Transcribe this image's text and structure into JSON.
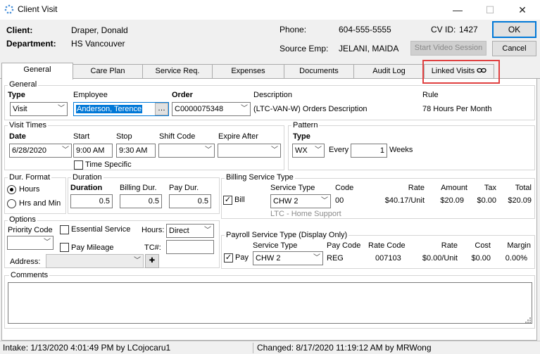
{
  "window": {
    "title": "Client Visit",
    "minimize_glyph": "—",
    "maximize_glyph": "☐",
    "close_glyph": "✕"
  },
  "header": {
    "client_label": "Client:",
    "client_value": "Draper, Donald",
    "department_label": "Department:",
    "department_value": "HS Vancouver",
    "phone_label": "Phone:",
    "phone_value": "604-555-5555",
    "cvid_label": "CV ID:",
    "cvid_value": "1427",
    "source_emp_label": "Source Emp:",
    "source_emp_value": "JELANI, MAIDA",
    "video_button": "Start Video Session",
    "ok_button": "OK",
    "cancel_button": "Cancel"
  },
  "tabs": [
    "General",
    "Care Plan",
    "Service Req.",
    "Expenses",
    "Documents",
    "Audit Log",
    "Linked Visits"
  ],
  "active_tab": "General",
  "general": {
    "group_label": "General",
    "type_label": "Type",
    "type_value": "Visit",
    "employee_label": "Employee",
    "employee_value": "Anderson, Terence",
    "employee_button": "…",
    "order_label": "Order",
    "order_value": "C0000075348",
    "description_label": "Description",
    "description_value": "(LTC-VAN-W) Orders Description",
    "rule_label": "Rule",
    "rule_value": "78 Hours Per Month"
  },
  "visit_times": {
    "group_label": "Visit Times",
    "date_label": "Date",
    "date_value": "6/28/2020",
    "start_label": "Start",
    "start_value": "9:00 AM",
    "stop_label": "Stop",
    "stop_value": "9:30 AM",
    "shift_code_label": "Shift Code",
    "shift_code_value": "",
    "expire_after_label": "Expire After",
    "expire_after_value": "",
    "time_specific_label": "Time Specific"
  },
  "pattern": {
    "group_label": "Pattern",
    "type_label": "Type",
    "type_value": "WX",
    "every_label": "Every",
    "every_value": "1",
    "weeks_label": "Weeks"
  },
  "dur_format": {
    "group_label": "Dur. Format",
    "hours_label": "Hours",
    "hrs_min_label": "Hrs and Min"
  },
  "duration": {
    "group_label": "Duration",
    "duration_label": "Duration",
    "duration_value": "0.5",
    "billing_dur_label": "Billing Dur.",
    "billing_dur_value": "0.5",
    "pay_dur_label": "Pay Dur.",
    "pay_dur_value": "0.5"
  },
  "billing": {
    "group_label": "Billing Service Type",
    "bill_label": "Bill",
    "service_type_label": "Service Type",
    "service_type_value": "CHW 2",
    "code_label": "Code",
    "code_value": "00",
    "rate_label": "Rate",
    "rate_value": "$40.17/Unit",
    "amount_label": "Amount",
    "amount_value": "$20.09",
    "tax_label": "Tax",
    "tax_value": "$0.00",
    "total_label": "Total",
    "total_value": "$20.09",
    "service_desc": "LTC - Home Support"
  },
  "options": {
    "group_label": "Options",
    "priority_code_label": "Priority Code",
    "essential_service_label": "Essential Service",
    "hours_label": "Hours:",
    "hours_value": "Direct",
    "pay_mileage_label": "Pay Mileage",
    "tc_label": "TC#:",
    "address_label": "Address:",
    "address_button": "✚"
  },
  "payroll": {
    "group_label": "Payroll Service Type (Display Only)",
    "pay_label": "Pay",
    "service_type_label": "Service Type",
    "service_type_value": "CHW 2",
    "pay_code_label": "Pay Code",
    "pay_code_value": "REG",
    "rate_code_label": "Rate Code",
    "rate_code_value": "007103",
    "rate_label": "Rate",
    "rate_value": "$0.00/Unit",
    "cost_label": "Cost",
    "cost_value": "$0.00",
    "margin_label": "Margin",
    "margin_value": "0.00%"
  },
  "comments": {
    "group_label": "Comments",
    "value": ""
  },
  "status": {
    "intake": "Intake: 1/13/2020 4:01:49 PM by LCojocaru1",
    "changed": "Changed: 8/17/2020 11:19:12 AM by MRWong"
  },
  "colors": {
    "accent": "#0078d7",
    "highlight": "#e04040",
    "selection": "#0078d7"
  }
}
